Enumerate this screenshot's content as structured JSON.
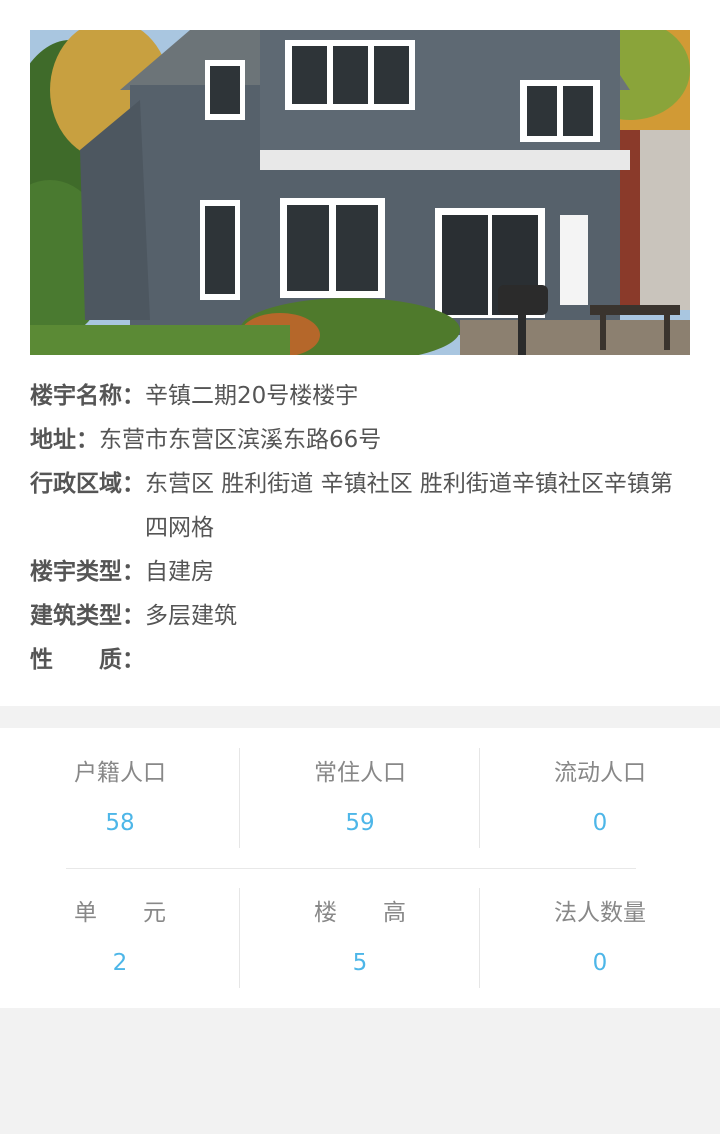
{
  "building": {
    "name_label": "楼宇名称：",
    "name_value": "辛镇二期20号楼楼宇",
    "address_label": "地址：",
    "address_value": "东营市东营区滨溪东路66号",
    "region_label": "行政区域：",
    "region_value": "东营区 胜利街道 辛镇社区 胜利街道辛镇社区辛镇第四网格",
    "type_label": "楼宇类型：",
    "type_value": "自建房",
    "arch_label": "建筑类型：",
    "arch_value": "多层建筑",
    "nature_label": "性　　质：",
    "nature_value": ""
  },
  "stats": {
    "row1": [
      {
        "label": "户籍人口",
        "value": "58"
      },
      {
        "label": "常住人口",
        "value": "59"
      },
      {
        "label": "流动人口",
        "value": "0"
      }
    ],
    "row2": [
      {
        "label": "单　　元",
        "value": "2"
      },
      {
        "label": "楼　　高",
        "value": "5"
      },
      {
        "label": "法人数量",
        "value": "0"
      }
    ]
  },
  "colors": {
    "accent": "#4db6e8",
    "label_gray": "#888888",
    "text_gray": "#555555",
    "background": "#f2f2f2"
  }
}
